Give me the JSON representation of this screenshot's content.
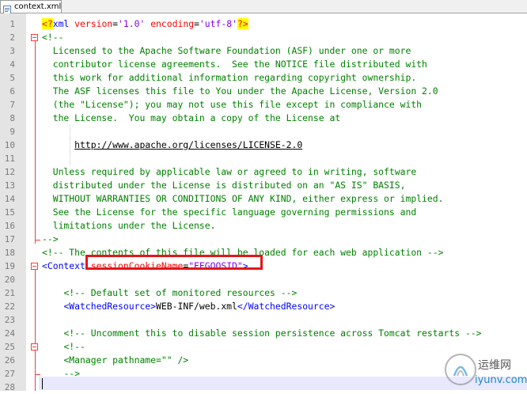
{
  "tab": {
    "label": "context.xml",
    "icon": "xml-file-icon"
  },
  "editor": {
    "colors": {
      "comment": "#008000",
      "tag": "#0000ff",
      "attribute": "#ff0000",
      "value": "#8000ff",
      "fold_marker": "#ff3b3b",
      "highlight_box": "#e0181b"
    },
    "lines": [
      {
        "n": "1",
        "parts": [
          [
            "pi",
            "<?"
          ],
          [
            "tg",
            "xml "
          ],
          [
            "at",
            "version"
          ],
          [
            "pl",
            "="
          ],
          [
            "vl",
            "'1.0'"
          ],
          [
            "pl",
            " "
          ],
          [
            "at",
            "encoding"
          ],
          [
            "pl",
            "="
          ],
          [
            "vl",
            "'utf-8'"
          ],
          [
            "pi",
            "?>"
          ]
        ]
      },
      {
        "n": "2",
        "fold": "start",
        "parts": [
          [
            "cm",
            "<!--"
          ]
        ]
      },
      {
        "n": "3",
        "parts": [
          [
            "cm",
            "  Licensed to the Apache Software Foundation (ASF) under one or more"
          ]
        ]
      },
      {
        "n": "4",
        "parts": [
          [
            "cm",
            "  contributor license agreements.  See the NOTICE file distributed with"
          ]
        ]
      },
      {
        "n": "5",
        "parts": [
          [
            "cm",
            "  this work for additional information regarding copyright ownership."
          ]
        ]
      },
      {
        "n": "6",
        "parts": [
          [
            "cm",
            "  The ASF licenses this file to You under the Apache License, Version 2.0"
          ]
        ]
      },
      {
        "n": "7",
        "parts": [
          [
            "cm",
            "  (the \"License\"); you may not use this file except in compliance with"
          ]
        ]
      },
      {
        "n": "8",
        "parts": [
          [
            "cm",
            "  the License.  You may obtain a copy of the License at"
          ]
        ]
      },
      {
        "n": "9",
        "parts": [],
        "guides": [
          1
        ]
      },
      {
        "n": "10",
        "parts": [
          [
            "cm",
            "      "
          ],
          [
            "url",
            "http://www.apache.org/licenses/LICENSE-2.0"
          ]
        ],
        "guides": [
          1
        ]
      },
      {
        "n": "11",
        "parts": [],
        "guides": [
          1
        ]
      },
      {
        "n": "12",
        "parts": [
          [
            "cm",
            "  Unless required by applicable law or agreed to in writing, software"
          ]
        ]
      },
      {
        "n": "13",
        "parts": [
          [
            "cm",
            "  distributed under the License is distributed on an \"AS IS\" BASIS,"
          ]
        ]
      },
      {
        "n": "14",
        "parts": [
          [
            "cm",
            "  WITHOUT WARRANTIES OR CONDITIONS OF ANY KIND, either express or implied."
          ]
        ]
      },
      {
        "n": "15",
        "parts": [
          [
            "cm",
            "  See the License for the specific language governing permissions and"
          ]
        ]
      },
      {
        "n": "16",
        "parts": [
          [
            "cm",
            "  limitations under the License."
          ]
        ]
      },
      {
        "n": "17",
        "fold": "end",
        "parts": [
          [
            "cm",
            "-->"
          ]
        ]
      },
      {
        "n": "18",
        "parts": [
          [
            "cm",
            "<!-- The contents of this file will be loaded for each web application -->"
          ]
        ]
      },
      {
        "n": "19",
        "fold": "start",
        "parts": [
          [
            "tg",
            "<Context"
          ],
          [
            "pl",
            " "
          ],
          [
            "at",
            "sessionCookieName"
          ],
          [
            "pl",
            "="
          ],
          [
            "vl",
            "\"EEGOOSID\""
          ],
          [
            "tg",
            ">"
          ]
        ]
      },
      {
        "n": "20",
        "parts": []
      },
      {
        "n": "21",
        "parts": [
          [
            "pl",
            "    "
          ],
          [
            "cm",
            "<!-- Default set of monitored resources -->"
          ]
        ]
      },
      {
        "n": "22",
        "parts": [
          [
            "pl",
            "    "
          ],
          [
            "tg",
            "<WatchedResource>"
          ],
          [
            "pl",
            "WEB-INF/web.xml"
          ],
          [
            "tg",
            "</WatchedResource>"
          ]
        ]
      },
      {
        "n": "23",
        "parts": []
      },
      {
        "n": "24",
        "parts": [
          [
            "pl",
            "    "
          ],
          [
            "cm",
            "<!-- Uncomment this to disable session persistence across Tomcat restarts -->"
          ]
        ]
      },
      {
        "n": "25",
        "fold": "start",
        "parts": [
          [
            "pl",
            "    "
          ],
          [
            "cm",
            "<!--"
          ]
        ]
      },
      {
        "n": "26",
        "parts": [
          [
            "pl",
            "    "
          ],
          [
            "cm",
            "<Manager pathname=\"\" />"
          ]
        ]
      },
      {
        "n": "27",
        "fold": "end",
        "parts": [
          [
            "pl",
            "    "
          ],
          [
            "cm",
            "-->"
          ]
        ]
      },
      {
        "n": "28",
        "parts": []
      }
    ]
  },
  "watermark": {
    "title": "运维网",
    "url": "iyunv.com",
    "icon": "yunwei-logo-icon"
  }
}
